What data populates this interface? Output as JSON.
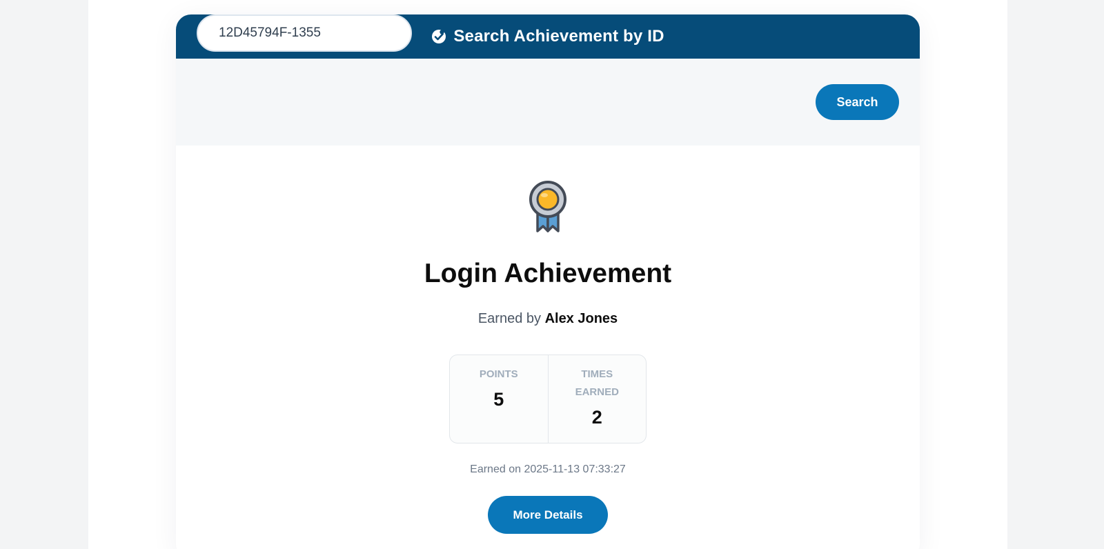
{
  "header": {
    "icon": "badge-check-icon",
    "title": "Search Achievement by ID",
    "background": "#064c79"
  },
  "search": {
    "value": "12D45794F-1355",
    "button_label": "Search"
  },
  "achievement": {
    "icon": "medal-icon",
    "title": "Login Achievement",
    "earned_by_prefix": "Earned by",
    "earned_by_name": "Alex Jones",
    "stats": {
      "points_label": "Points",
      "points_value": "5",
      "times_label": "Times Earned",
      "times_value": "2"
    },
    "earned_on": "Earned on 2025-11-13 07:33:27",
    "details_button_label": "More Details"
  },
  "colors": {
    "accent": "#0a77b9",
    "header": "#064c79"
  }
}
